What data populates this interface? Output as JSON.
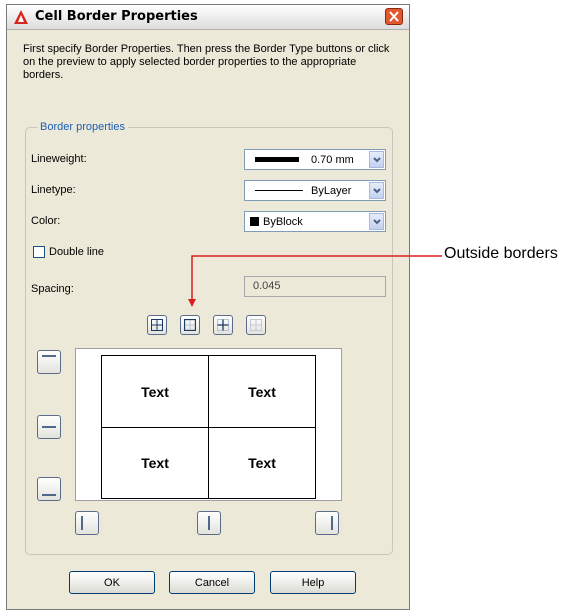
{
  "window": {
    "title": "Cell Border Properties"
  },
  "description": "First specify Border Properties. Then press the Border Type buttons or click on the preview to apply selected border properties to the appropriate borders.",
  "border_properties": {
    "group_label": "Border properties",
    "lineweight": {
      "label": "Lineweight:",
      "value": "0.70 mm"
    },
    "linetype": {
      "label": "Linetype:",
      "value": "ByLayer"
    },
    "color": {
      "label": "Color:",
      "value": "ByBlock",
      "swatch": "#000000"
    },
    "double_line": {
      "label": "Double line",
      "checked": false
    },
    "spacing": {
      "label": "Spacing:",
      "value": "0.045"
    }
  },
  "border_type_buttons": [
    {
      "name": "all-borders",
      "icon": "all-borders-icon"
    },
    {
      "name": "outside-borders",
      "icon": "outside-borders-icon"
    },
    {
      "name": "inside-borders",
      "icon": "inside-borders-icon"
    },
    {
      "name": "no-borders",
      "icon": "no-borders-icon"
    }
  ],
  "preview": {
    "cells": [
      "Text",
      "Text",
      "Text",
      "Text"
    ]
  },
  "buttons": {
    "ok": "OK",
    "cancel": "Cancel",
    "help": "Help"
  },
  "callout": {
    "text": "Outside borders",
    "color": "#d92020"
  }
}
